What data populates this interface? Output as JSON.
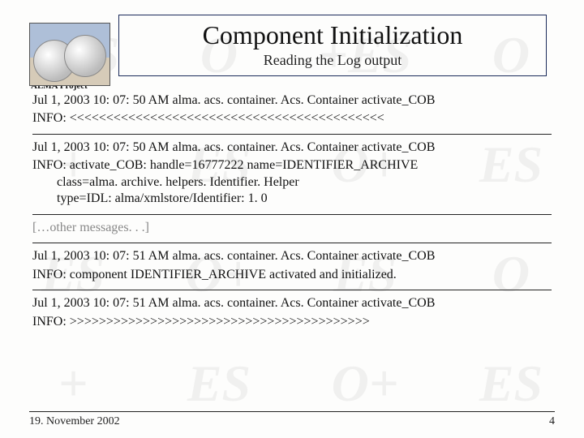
{
  "header": {
    "title": "Component Initialization",
    "subtitle": "Reading the Log output",
    "project_label": "ALMA Project"
  },
  "log": {
    "entry1_line1": "Jul 1, 2003 10: 07: 50 AM alma. acs. container. Acs. Container activate_COB",
    "entry1_info": "INFO: <<<<<<<<<<<<<<<<<<<<<<<<<<<<<<<<<<<<<<<<<<<",
    "entry2_line1": "Jul 1, 2003 10: 07: 50 AM alma. acs. container. Acs. Container activate_COB",
    "entry2_info_a": "INFO: activate_COB: handle=16777222 name=IDENTIFIER_ARCHIVE",
    "entry2_info_b": "class=alma. archive. helpers. Identifier. Helper",
    "entry2_info_c": "type=IDL: alma/xmlstore/Identifier: 1. 0",
    "placeholder": "[…other messages. . .]",
    "entry3_line1": "Jul 1, 2003 10: 07: 51 AM alma. acs. container. Acs. Container activate_COB",
    "entry3_info": "INFO: component IDENTIFIER_ARCHIVE activated and initialized.",
    "entry4_line1": "Jul 1, 2003 10: 07: 51 AM alma. acs. container. Acs. Container activate_COB",
    "entry4_info": "INFO: >>>>>>>>>>>>>>>>>>>>>>>>>>>>>>>>>>>>>>>>>"
  },
  "footer": {
    "date": "19. November 2002",
    "page": "4"
  }
}
